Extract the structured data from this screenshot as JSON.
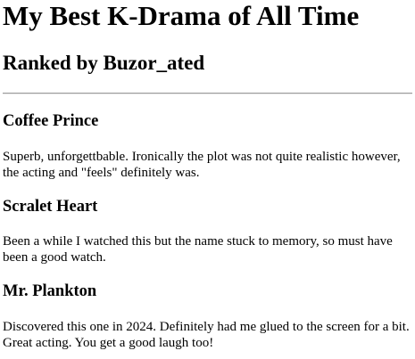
{
  "page": {
    "title": "My Best K-Drama of All Time",
    "subtitle": "Ranked by Buzor_ated"
  },
  "entries": [
    {
      "title": "Coffee Prince",
      "review": "Superb, unforgettbable. Ironically the plot was not quite realistic however, the acting and \"feels\" definitely was."
    },
    {
      "title": "Scralet Heart",
      "review": "Been a while I watched this but the name stuck to memory, so must have been a good watch."
    },
    {
      "title": "Mr. Plankton",
      "review": "Discovered this one in 2024. Definitely had me glued to the screen for a bit. Great acting. You get a good laugh too!"
    }
  ]
}
